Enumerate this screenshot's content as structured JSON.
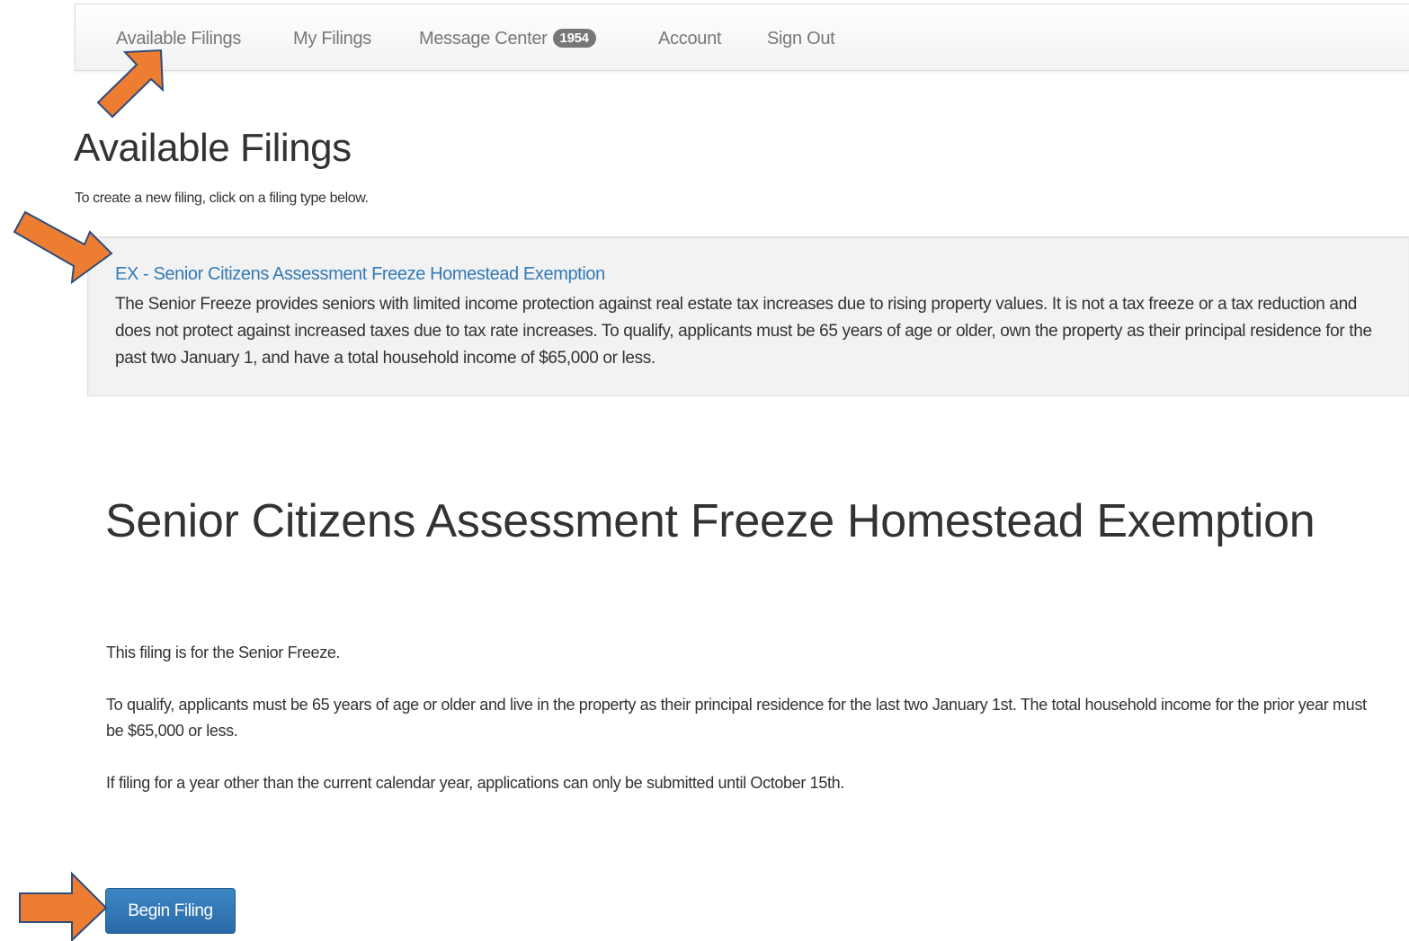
{
  "nav": {
    "items": [
      {
        "label": "Available Filings"
      },
      {
        "label": "My Filings"
      },
      {
        "label": "Message Center",
        "badge": "1954"
      },
      {
        "label": "Account"
      },
      {
        "label": "Sign Out"
      }
    ]
  },
  "header": {
    "title": "Available Filings",
    "subtitle": "To create a new filing, click on a filing type below."
  },
  "filing": {
    "link_text": "EX - Senior Citizens Assessment Freeze Homestead Exemption",
    "description": "The Senior Freeze provides seniors with limited income protection against real estate tax increases due to rising property values. It is not a tax freeze or a tax reduction and does not protect against increased taxes due to tax rate increases. To qualify, applicants must be 65 years of age or older, own the property as their principal residence for the past two January 1, and have a total household income of $65,000 or less."
  },
  "detail": {
    "title": "Senior Citizens Assessment Freeze Homestead Exemption",
    "paragraphs": [
      "This filing is for the Senior Freeze.",
      "To qualify, applicants must be 65 years of age or older and live in the property as their principal residence for the last two January 1st. The total household income for the prior year must be $65,000 or less.",
      "If filing for a year other than the current calendar year, applications can only be submitted until October 15th."
    ],
    "begin_label": "Begin Filing"
  },
  "colors": {
    "arrow_fill": "#ed7d31",
    "arrow_stroke": "#2f4b7c",
    "link": "#337ab7",
    "button": "#2f72b0"
  },
  "icons": {
    "annotation": "orange-arrow-icon"
  }
}
